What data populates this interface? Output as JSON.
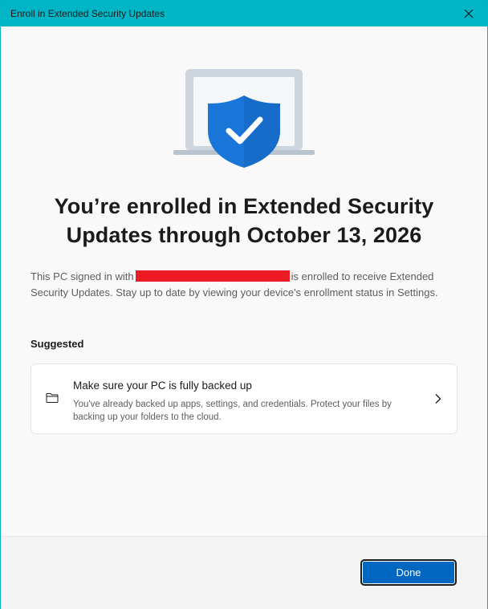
{
  "window": {
    "title": "Enroll in Extended Security Updates"
  },
  "main": {
    "heading": "You’re enrolled in Extended Security Updates through October 13, 2026",
    "description_before": "This PC signed in with",
    "description_after": "is enrolled to receive Extended Security Updates. Stay up to date by viewing your device's enrollment status in Settings."
  },
  "suggested": {
    "label": "Suggested",
    "card": {
      "title": "Make sure your PC is fully backed up",
      "description": "You've already backed up apps, settings, and credentials. Protect your files by backing up your folders to the cloud."
    }
  },
  "footer": {
    "done_label": "Done"
  },
  "icons": {
    "close": "close-icon",
    "hero": "laptop-shield-check-icon",
    "card": "folder-icon",
    "chevron": "chevron-right-icon"
  },
  "colors": {
    "titlebar": "#00b5c5",
    "accent": "#0067c0",
    "shield": "#1976d8",
    "redaction": "#ed1c24"
  }
}
